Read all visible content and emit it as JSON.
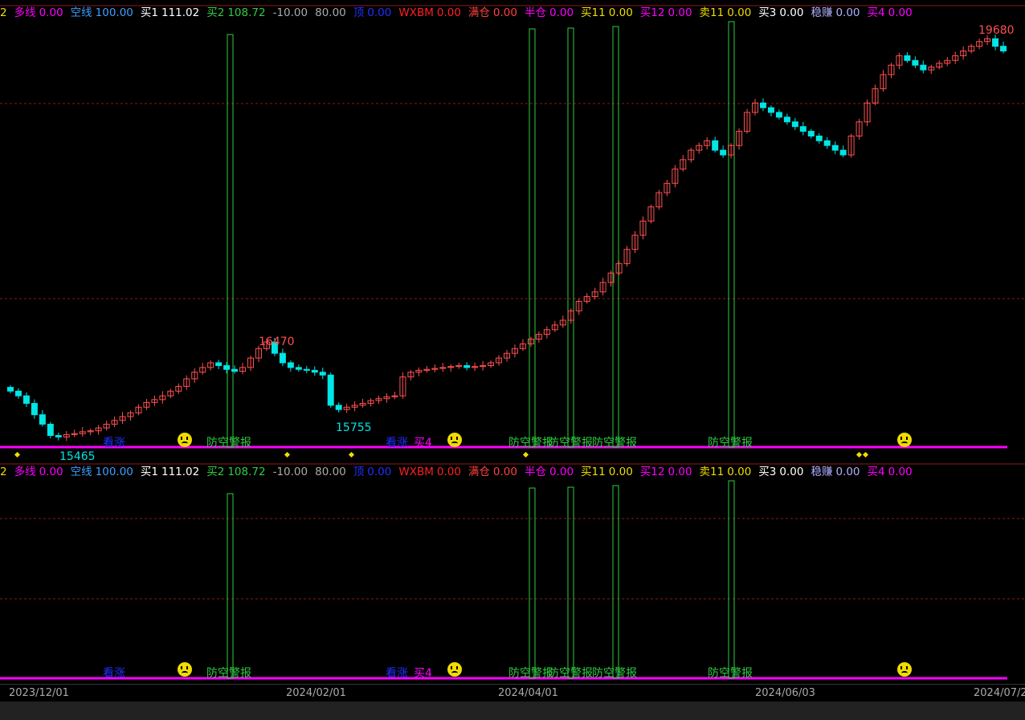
{
  "colors": {
    "up": "#ff5050",
    "down": "#00e5e5",
    "signal_bar": "#2ecc40",
    "baseline": "#ff00ff",
    "grid": "#8b1a1a",
    "smiley": "#f0dc00"
  },
  "legend": [
    {
      "label": "2",
      "value": "",
      "color": "#f0dc00"
    },
    {
      "label": "多线",
      "value": "0.00",
      "color": "#ff00ff"
    },
    {
      "label": "空线",
      "value": "100.00",
      "color": "#3ca0ff"
    },
    {
      "label": "买1",
      "value": "111.02",
      "color": "#ffffff"
    },
    {
      "label": "买2",
      "value": "108.72",
      "color": "#2ecc40"
    },
    {
      "label": "",
      "value": "-10.00",
      "color": "#aaaaaa"
    },
    {
      "label": "",
      "value": "80.00",
      "color": "#aaaaaa"
    },
    {
      "label": "顶",
      "value": "0.00",
      "color": "#2030ff"
    },
    {
      "label": "WXBM",
      "value": "0.00",
      "color": "#ff2020"
    },
    {
      "label": "满仓",
      "value": "0.00",
      "color": "#ff4040"
    },
    {
      "label": "半仓",
      "value": "0.00",
      "color": "#ff00ff"
    },
    {
      "label": "买11",
      "value": "0.00",
      "color": "#f0dc00"
    },
    {
      "label": "买12",
      "value": "0.00",
      "color": "#ff00ff"
    },
    {
      "label": "卖11",
      "value": "0.00",
      "color": "#f0dc00"
    },
    {
      "label": "买3",
      "value": "0.00",
      "color": "#ffffff"
    },
    {
      "label": "稳赚",
      "value": "0.00",
      "color": "#b0b0ff"
    },
    {
      "label": "买4",
      "value": "0.00",
      "color": "#ff00ff"
    }
  ],
  "price_labels": {
    "high_left": "16470",
    "low_left": "15465",
    "low_mid": "15755",
    "high_right": "19680"
  },
  "signals": {
    "kanzhang": "看涨",
    "mai4": "买4",
    "fangkong": "防空警报"
  },
  "date_axis": [
    "2023/12/01",
    "2024/02/01",
    "2024/04/01",
    "2024/06/03",
    "2024/07/2"
  ],
  "chart_data": {
    "type": "candlestick",
    "price_range_visible": [
      15400,
      19750
    ],
    "annotated_high": 19680,
    "annotated_lows": [
      15465,
      15755
    ],
    "annotated_local_high": 16470,
    "close_series": [
      15950,
      15900,
      15820,
      15700,
      15600,
      15480,
      15465,
      15490,
      15500,
      15520,
      15530,
      15560,
      15600,
      15640,
      15680,
      15720,
      15780,
      15830,
      15860,
      15900,
      15950,
      16000,
      16080,
      16150,
      16200,
      16250,
      16220,
      16180,
      16160,
      16200,
      16300,
      16400,
      16470,
      16350,
      16250,
      16200,
      16180,
      16170,
      16150,
      16120,
      15800,
      15755,
      15780,
      15800,
      15820,
      15850,
      15870,
      15890,
      15900,
      16100,
      16150,
      16170,
      16180,
      16190,
      16200,
      16210,
      16220,
      16200,
      16210,
      16220,
      16250,
      16300,
      16350,
      16400,
      16450,
      16500,
      16550,
      16600,
      16650,
      16700,
      16800,
      16900,
      16950,
      17000,
      17100,
      17200,
      17300,
      17450,
      17600,
      17750,
      17900,
      18050,
      18150,
      18300,
      18400,
      18500,
      18550,
      18600,
      18500,
      18450,
      18550,
      18700,
      18900,
      19000,
      18950,
      18900,
      18850,
      18800,
      18750,
      18700,
      18650,
      18600,
      18550,
      18500,
      18450,
      18650,
      18800,
      19000,
      19150,
      19300,
      19400,
      19500,
      19450,
      19400,
      19350,
      19380,
      19420,
      19450,
      19500,
      19550,
      19600,
      19650,
      19680,
      19600,
      19550
    ]
  }
}
